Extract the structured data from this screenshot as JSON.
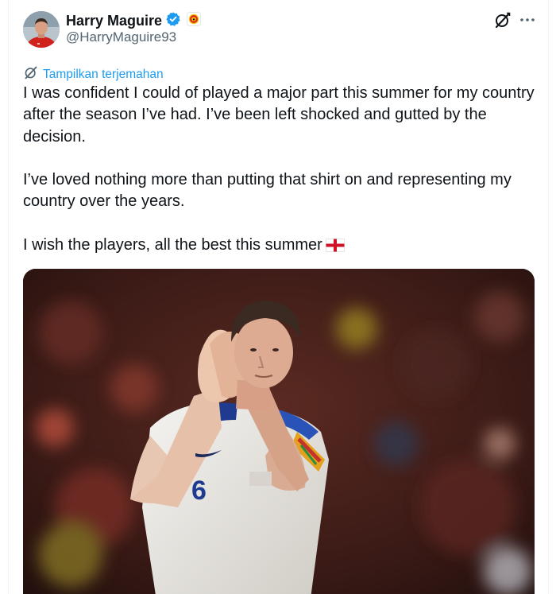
{
  "author": {
    "display_name": "Harry Maguire",
    "handle": "@HarryMaguire93",
    "verified_icon": "verified-badge-icon",
    "affiliate_icon": "club-crest-icon",
    "colors": {
      "verified": "#1d9bf0",
      "crest": "#da291c"
    }
  },
  "header_actions": {
    "grok_icon": "grok-icon",
    "more_icon": "more-dots-icon"
  },
  "translate": {
    "icon": "grok-translate-icon",
    "label": "Tampilkan terjemahan"
  },
  "tweet": {
    "paragraphs": [
      "I was confident I could of played a major part this summer for my country after the season I’ve had. I’ve been left shocked and gutted by the decision.",
      "I’ve loved nothing more than putting that shirt on and representing my country over the years.",
      "I wish the players, all the best this summer"
    ],
    "emoji": "england-flag-emoji"
  },
  "media": {
    "type": "photo",
    "shirt_number": "6"
  }
}
